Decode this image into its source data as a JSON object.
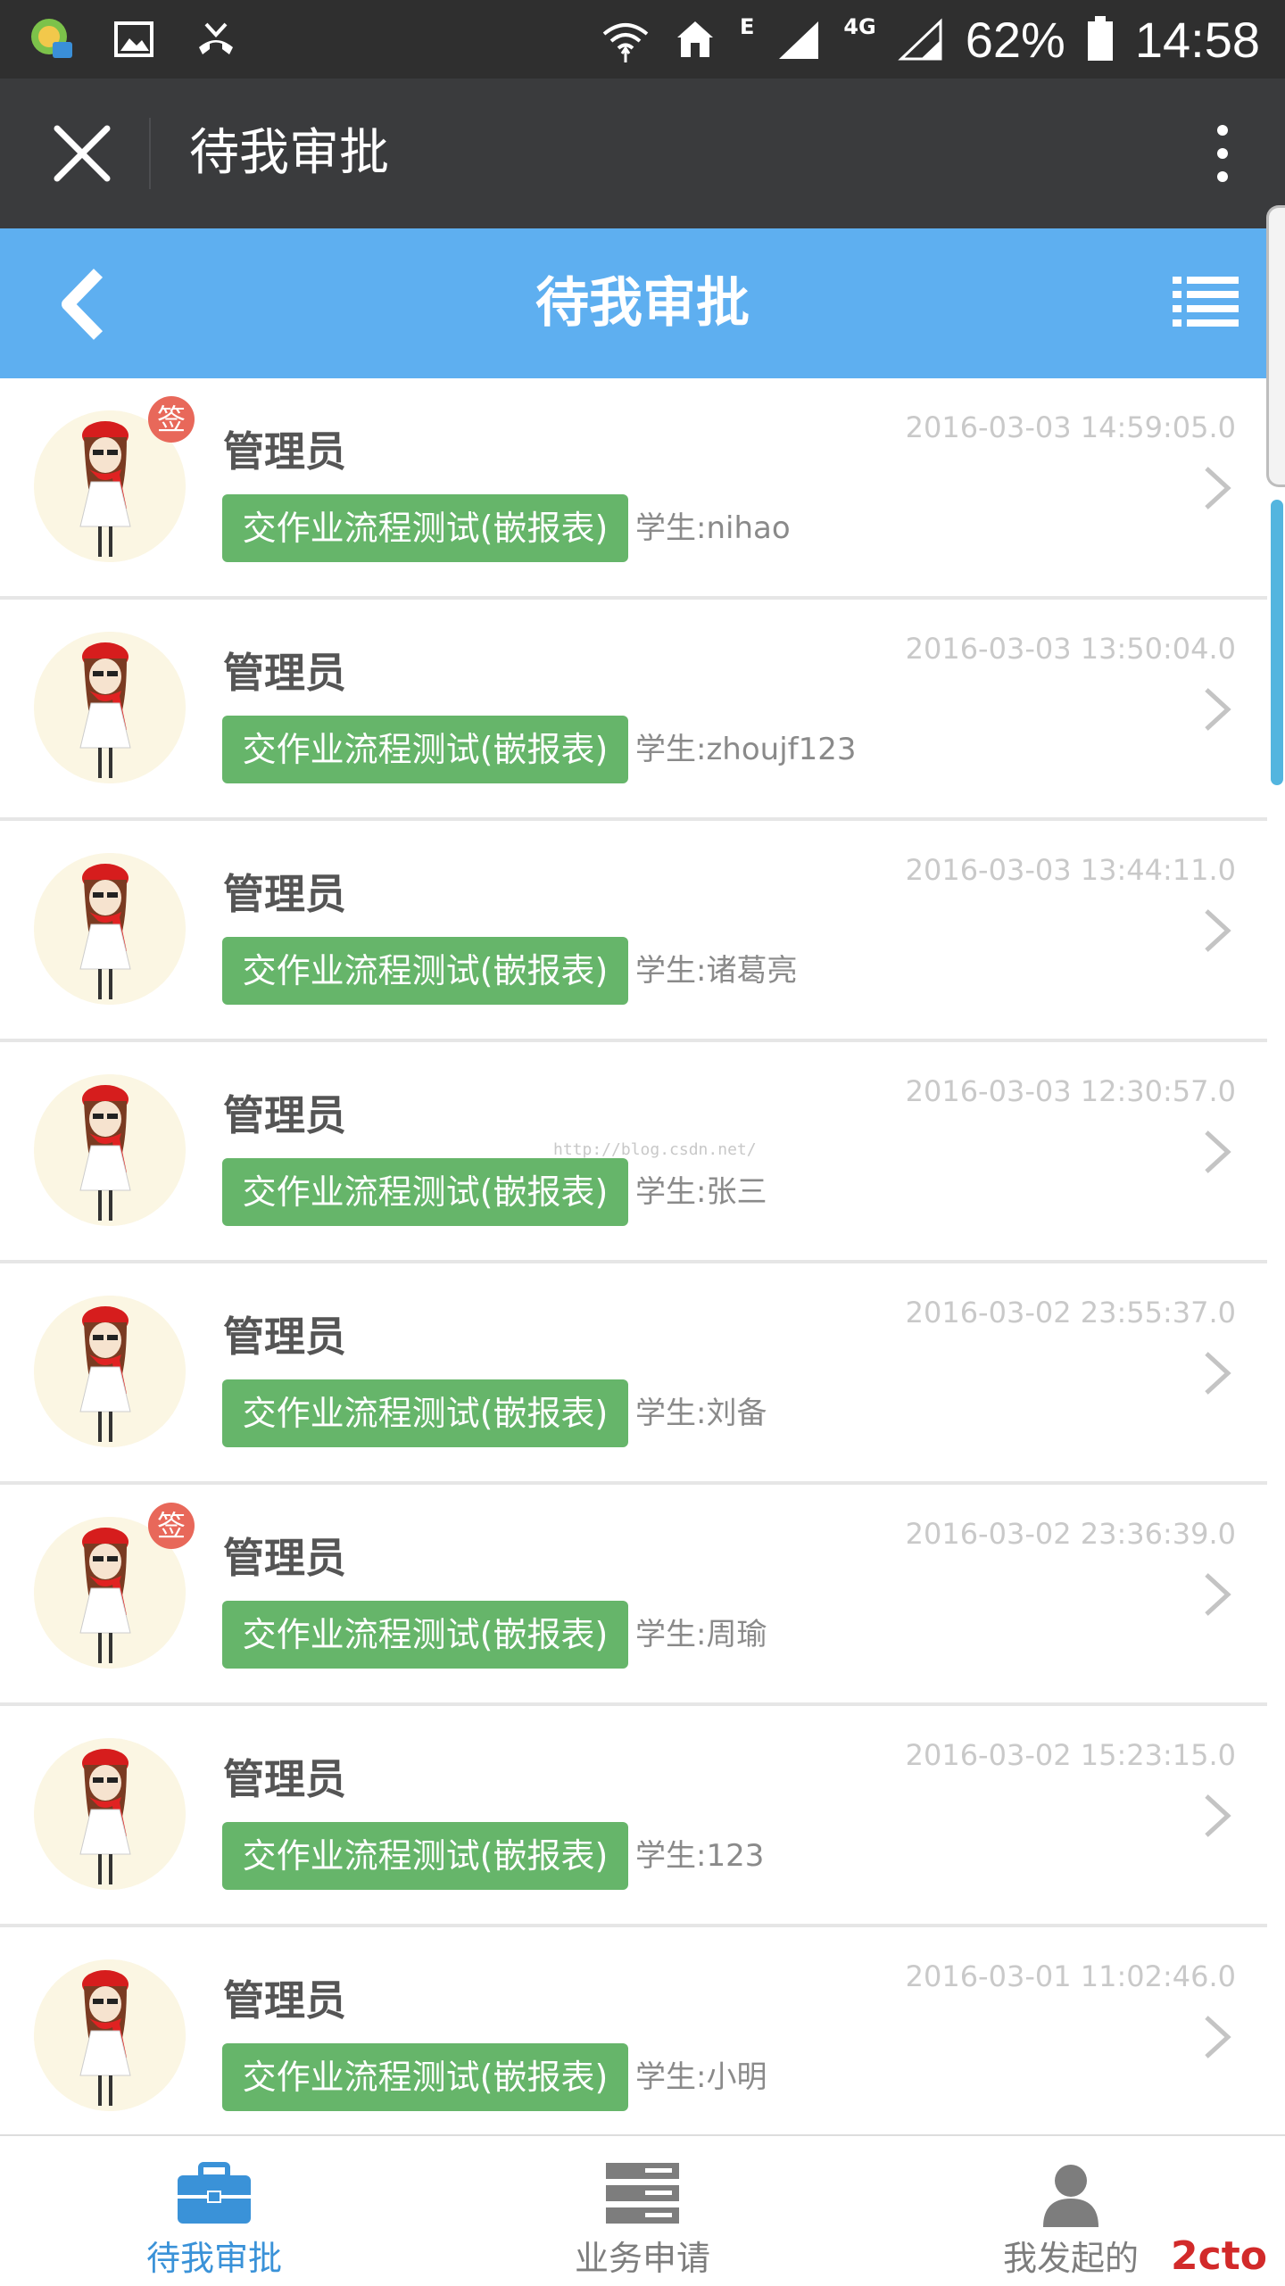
{
  "status_bar": {
    "battery": "62%",
    "time": "14:58",
    "network_e": "E",
    "network_4g": "4G"
  },
  "title_bar": {
    "title": "待我审批"
  },
  "nav_bar": {
    "title": "待我审批"
  },
  "list": [
    {
      "name": "管理员",
      "tag": "交作业流程测试(嵌报表)",
      "student": "学生:nihao",
      "time": "2016-03-03 14:59:05.0",
      "badge": "签"
    },
    {
      "name": "管理员",
      "tag": "交作业流程测试(嵌报表)",
      "student": "学生:zhoujf123",
      "time": "2016-03-03 13:50:04.0",
      "badge": ""
    },
    {
      "name": "管理员",
      "tag": "交作业流程测试(嵌报表)",
      "student": "学生:诸葛亮",
      "time": "2016-03-03 13:44:11.0",
      "badge": ""
    },
    {
      "name": "管理员",
      "tag": "交作业流程测试(嵌报表)",
      "student": "学生:张三",
      "time": "2016-03-03 12:30:57.0",
      "badge": ""
    },
    {
      "name": "管理员",
      "tag": "交作业流程测试(嵌报表)",
      "student": "学生:刘备",
      "time": "2016-03-02 23:55:37.0",
      "badge": ""
    },
    {
      "name": "管理员",
      "tag": "交作业流程测试(嵌报表)",
      "student": "学生:周瑜",
      "time": "2016-03-02 23:36:39.0",
      "badge": "签"
    },
    {
      "name": "管理员",
      "tag": "交作业流程测试(嵌报表)",
      "student": "学生:123",
      "time": "2016-03-02 15:23:15.0",
      "badge": ""
    },
    {
      "name": "管理员",
      "tag": "交作业流程测试(嵌报表)",
      "student": "学生:小明",
      "time": "2016-03-01 11:02:46.0",
      "badge": ""
    }
  ],
  "watermark": "http://blog.csdn.net/",
  "tabs": [
    {
      "label": "待我审批",
      "icon": "briefcase-icon",
      "active": true
    },
    {
      "label": "业务申请",
      "icon": "server-stack-icon",
      "active": false
    },
    {
      "label": "我发起的",
      "icon": "user-icon",
      "active": false
    }
  ],
  "logo": "2cto",
  "colors": {
    "nav_blue": "#5eaff0",
    "tag_green": "#66b56a",
    "badge_red": "#e8685a",
    "tab_active": "#3a92d8",
    "tab_inactive": "#7d7d7d"
  }
}
